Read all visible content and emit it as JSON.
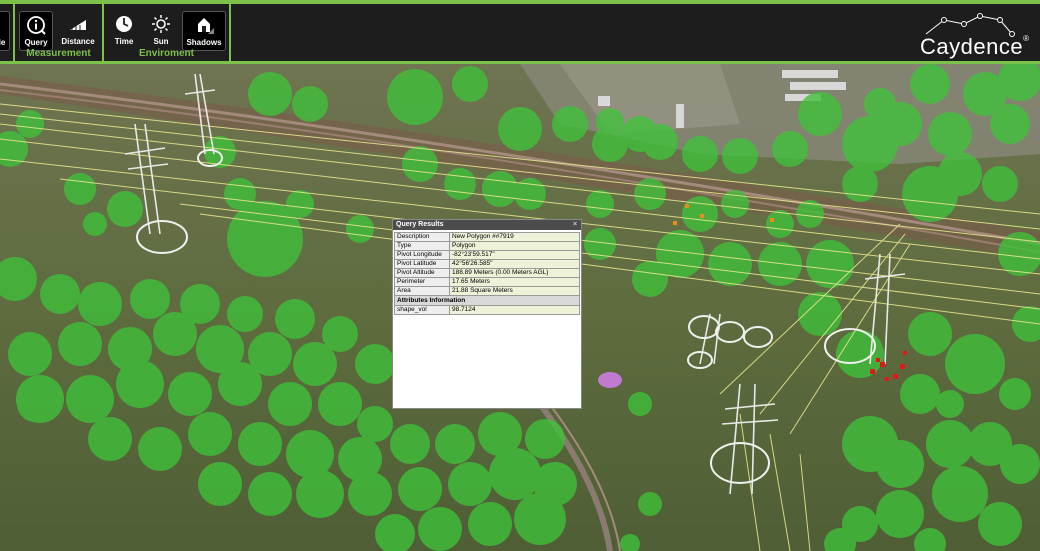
{
  "toolbar": {
    "measurement": {
      "label": "Measurement",
      "buttons": [
        {
          "label": "Query",
          "icon": "query-info-icon",
          "active": true
        },
        {
          "label": "Distance",
          "icon": "distance-ruler-icon",
          "active": false
        }
      ]
    },
    "environment": {
      "label": "Enviroment",
      "buttons": [
        {
          "label": "Time",
          "icon": "clock-icon",
          "active": false
        },
        {
          "label": "Sun",
          "icon": "sun-icon",
          "active": false
        },
        {
          "label": "Shadows",
          "icon": "shadows-icon",
          "active": true
        }
      ]
    },
    "partial_left_button_label": "le"
  },
  "logo": {
    "text": "Caydence",
    "reg": "®"
  },
  "query_results": {
    "title": "Query Results",
    "close": "×",
    "rows": [
      {
        "key": "Description",
        "value": "New Polygon ##7919"
      },
      {
        "key": "Type",
        "value": "Polygon"
      },
      {
        "key": "Pivot Longitude",
        "value": "-82°23'59.517\""
      },
      {
        "key": "Pivot Latitude",
        "value": "42°56'26.585\""
      },
      {
        "key": "Pivot Altitude",
        "value": "188.89 Meters (0.00 Meters AGL)"
      },
      {
        "key": "Perimeter",
        "value": "17.65 Meters"
      },
      {
        "key": "Area",
        "value": "21.88 Square Meters"
      }
    ],
    "attributes_header": "Attributes Information",
    "attributes": [
      {
        "key": "shape_vol",
        "value": "98.7124"
      }
    ]
  },
  "colors": {
    "accent": "#7cc24a",
    "toolbar_bg": "#1d1d1d",
    "tree_fill": "#3fc23a",
    "selected_polygon": "#c07ad0",
    "marker_red": "#e01818",
    "marker_orange": "#f08a18"
  }
}
